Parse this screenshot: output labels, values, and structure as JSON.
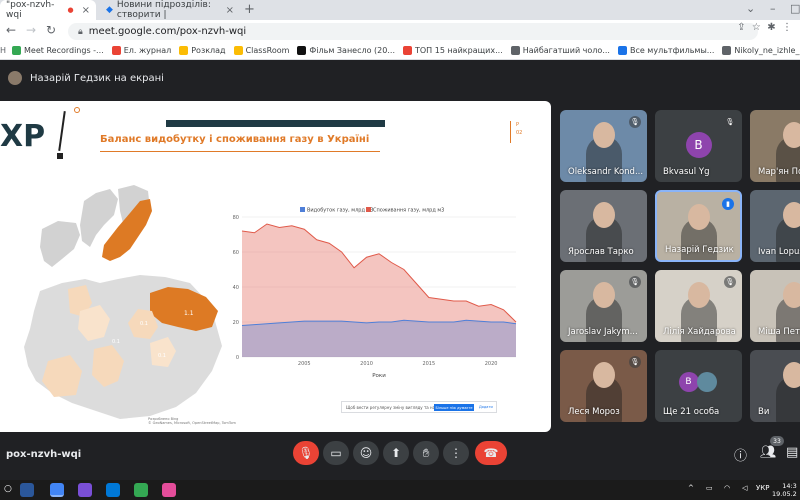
{
  "browser": {
    "tabs": [
      {
        "label": "\"pox-nzvh-wqi",
        "active": true
      },
      {
        "label": "Новини підрозділів: створити |",
        "active": false
      }
    ],
    "url": "meet.google.com/pox-nzvh-wqi",
    "bookmarks": [
      {
        "label": "Meet Recordings -...",
        "color": "#34a853"
      },
      {
        "label": "Ел. журнал",
        "color": "#ea4335"
      },
      {
        "label": "Розклад",
        "color": "#fbbc04"
      },
      {
        "label": "ClassRoom",
        "color": "#fbbc04"
      },
      {
        "label": "Фільм Занесло (20...",
        "color": "#111111"
      },
      {
        "label": "ТОП 15 найкращих...",
        "color": "#ea4335"
      },
      {
        "label": "Найбагатший чоло...",
        "color": "#5f6368"
      },
      {
        "label": "Все мультфильмы...",
        "color": "#1a73e8"
      },
      {
        "label": "Nikoly_ne_izhle_na...",
        "color": "#5f6368"
      }
    ]
  },
  "meet": {
    "presenter_label": "Назарій Гедзик на екрані",
    "meeting_code": "pox-nzvh-wqi",
    "participant_count": "33",
    "participants": [
      {
        "name": "Oleksandr Kond...",
        "type": "video",
        "bg": "#6d8aa8",
        "mic": "muted"
      },
      {
        "name": "Bkvasul Yg",
        "type": "letter",
        "letter": "B",
        "avatar": "#8e44ad",
        "mic": "muted"
      },
      {
        "name": "Мар'ян Пси",
        "type": "video",
        "bg": "#8a7a66",
        "mic": "none"
      },
      {
        "name": "Ярослав Тарко",
        "type": "video",
        "bg": "#6b6f75",
        "mic": "none"
      },
      {
        "name": "Назарій Гедзик",
        "type": "video",
        "bg": "#b9b1a3",
        "mic": "speaking"
      },
      {
        "name": "Ivan Lopush",
        "type": "video",
        "bg": "#5c6670",
        "mic": "none"
      },
      {
        "name": "Jaroslav Jakym...",
        "type": "video",
        "bg": "#9c9c98",
        "mic": "muted"
      },
      {
        "name": "Лілія Хайдарова",
        "type": "video",
        "bg": "#d6d1c8",
        "mic": "muted"
      },
      {
        "name": "Міша Петр",
        "type": "video",
        "bg": "#c8c2b8",
        "mic": "none"
      },
      {
        "name": "Леся Мороз",
        "type": "video",
        "bg": "#7a5a48",
        "mic": "muted"
      },
      {
        "name": "Ще 21 особа",
        "type": "more",
        "letter": "B",
        "avatar": "#8e44ad",
        "mic": "none"
      },
      {
        "name": "Ви",
        "type": "video",
        "bg": "#4a4d52",
        "mic": "none"
      }
    ]
  },
  "slide": {
    "logo": "XP",
    "title": "Баланс видобутку і споживання газу в Україні",
    "page_label": "P\n02",
    "map_labels": [
      "1.1",
      "0.1",
      "0.1",
      "0.1"
    ],
    "map_credit": "Розроблено Bing\n© GeoNames, Microsoft, OpenStreetMap, TomTom",
    "popup_text": "Щоб вести регулярну зміну вигляду та назви",
    "popup_button": "Більше ніж думаєте",
    "popup_link": "Додати"
  },
  "chart_data": {
    "type": "area",
    "legend": [
      "Видобуток газу, млрд м3",
      "Споживання газу, млрд м3"
    ],
    "legend_position": "top",
    "xlabel": "Роки",
    "ylabel": "",
    "x": [
      2000,
      2001,
      2002,
      2003,
      2004,
      2005,
      2006,
      2007,
      2008,
      2009,
      2010,
      2011,
      2012,
      2013,
      2014,
      2015,
      2016,
      2017,
      2018,
      2019,
      2020,
      2021,
      2022
    ],
    "x_ticks": [
      2005,
      2010,
      2015,
      2020
    ],
    "ylim": [
      0,
      80
    ],
    "y_ticks": [
      0,
      20,
      40,
      60,
      80
    ],
    "grid": true,
    "series": [
      {
        "name": "Видобуток газу, млрд м3",
        "color": "#4f7fd8",
        "values": [
          18,
          18.5,
          19,
          19.5,
          20,
          20.5,
          20.5,
          20.5,
          20.5,
          20,
          19.5,
          20,
          20,
          21,
          20.5,
          20,
          20,
          20,
          21,
          20.5,
          20,
          20,
          19
        ]
      },
      {
        "name": "Споживання газу, млрд м3",
        "color": "#e05a4a",
        "values": [
          72,
          71,
          76,
          74,
          75,
          73,
          67,
          65,
          60,
          51,
          57,
          59,
          54,
          50,
          42,
          34,
          33,
          32,
          32,
          29,
          30,
          27,
          20
        ]
      }
    ]
  },
  "system": {
    "lang": "УКР",
    "time": "14:3",
    "date": "19.05.2"
  }
}
